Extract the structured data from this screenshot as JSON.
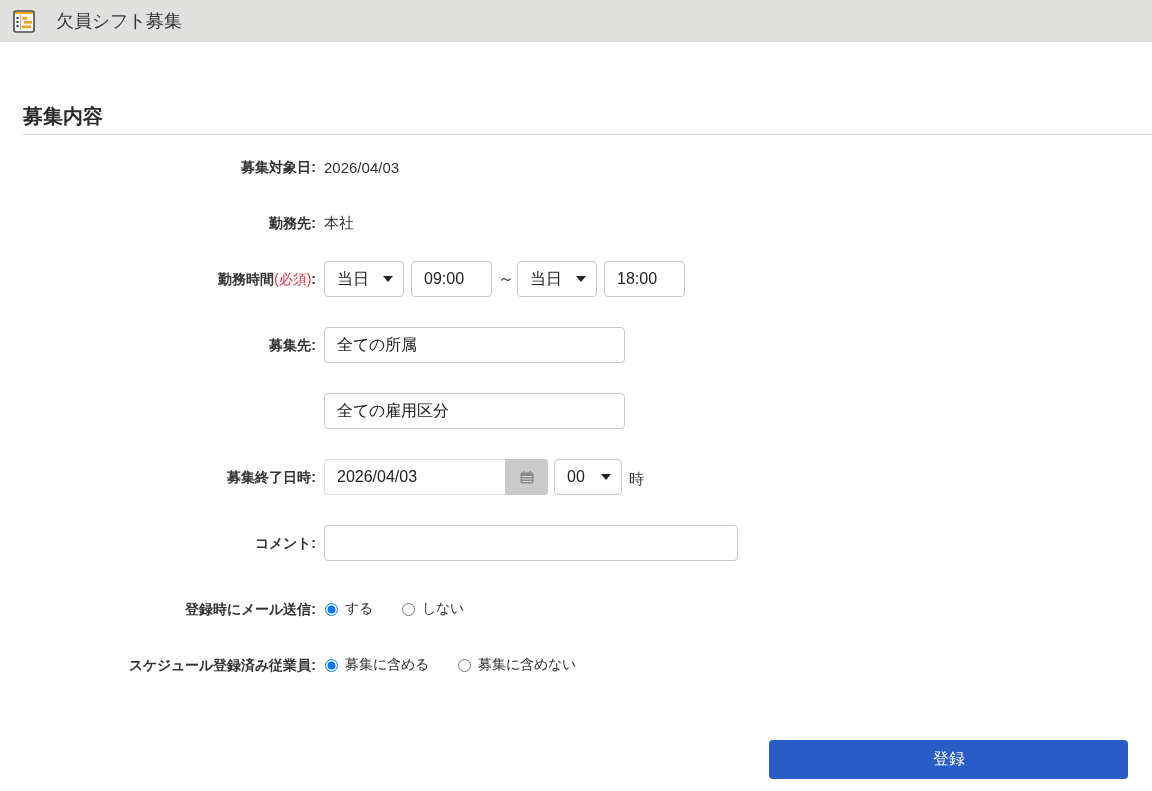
{
  "window": {
    "title": "欠員シフト募集"
  },
  "section": {
    "title": "募集内容"
  },
  "fields": [
    {
      "kind": "static",
      "label": "募集対象日:",
      "value": "2026/04/03"
    },
    {
      "kind": "static",
      "label": "勤務先:",
      "value": "本社"
    },
    {
      "kind": "time_range",
      "label": "勤務時間",
      "required_note": "(必須)",
      "label_tail": ":",
      "start_day": "当日",
      "start_time": "09:00",
      "separator": "～",
      "end_day": "当日",
      "end_time": "18:00"
    },
    {
      "kind": "picker",
      "label": "募集先:",
      "value": "全ての所属"
    },
    {
      "kind": "picker",
      "value": "全ての雇用区分"
    },
    {
      "kind": "datetime",
      "label": "募集終了日時:",
      "date": "2026/04/03",
      "hour": "00",
      "unit": "時"
    },
    {
      "kind": "input",
      "label": "コメント:"
    },
    {
      "kind": "radio",
      "label": "登録時にメール送信:",
      "options": [
        {
          "label": "する",
          "selected": true
        },
        {
          "label": "しない",
          "selected": false
        }
      ]
    },
    {
      "kind": "radio",
      "label": "スケジュール登録済み従業員:",
      "options": [
        {
          "label": "募集に含める",
          "selected": true
        },
        {
          "label": "募集に含めない",
          "selected": false
        }
      ]
    }
  ],
  "submit_button": {
    "label": "登録"
  }
}
